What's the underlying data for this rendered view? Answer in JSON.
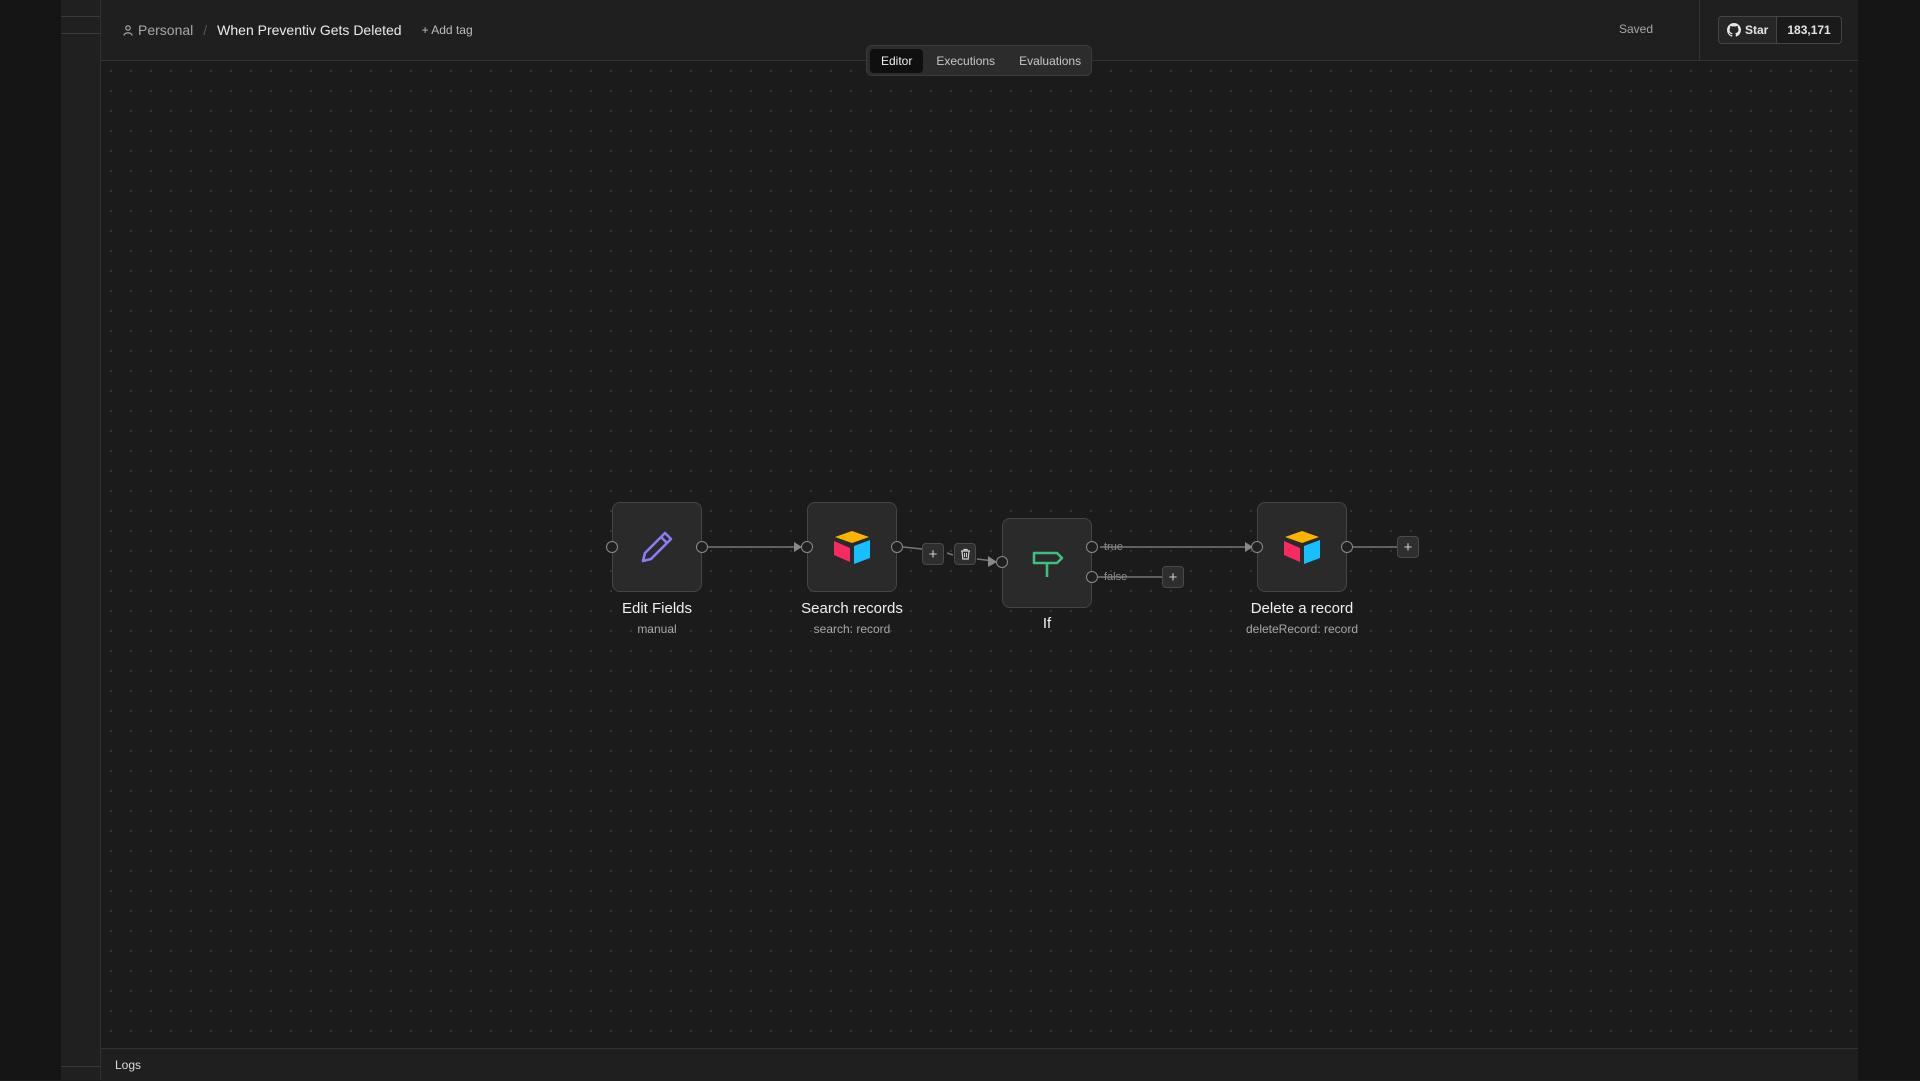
{
  "header": {
    "breadcrumb_home": "Personal",
    "workflow_title": "When Preventiv Gets Deleted",
    "add_tag": "+ Add tag",
    "status": "Saved",
    "github_star": "Star",
    "github_count": "183,171"
  },
  "tabs": [
    {
      "label": "Editor",
      "active": true
    },
    {
      "label": "Executions",
      "active": false
    },
    {
      "label": "Evaluations",
      "active": false
    }
  ],
  "nodes": [
    {
      "name": "Edit Fields",
      "subtitle": "manual",
      "icon": "pencil-icon"
    },
    {
      "name": "Search records",
      "subtitle": "search: record",
      "icon": "airtable-icon"
    },
    {
      "name": "If",
      "subtitle": "",
      "icon": "signpost-icon"
    },
    {
      "name": "Delete a record",
      "subtitle": "deleteRecord: record",
      "icon": "airtable-icon"
    }
  ],
  "edge_labels": {
    "true": "true",
    "false": "false"
  },
  "footer": {
    "logs": "Logs"
  },
  "colors": {
    "pencil": "#8b7cf6",
    "if_green": "#3fbf7f",
    "airtable_yellow": "#fcb400",
    "airtable_red": "#f82b60",
    "airtable_blue": "#18bfff"
  }
}
